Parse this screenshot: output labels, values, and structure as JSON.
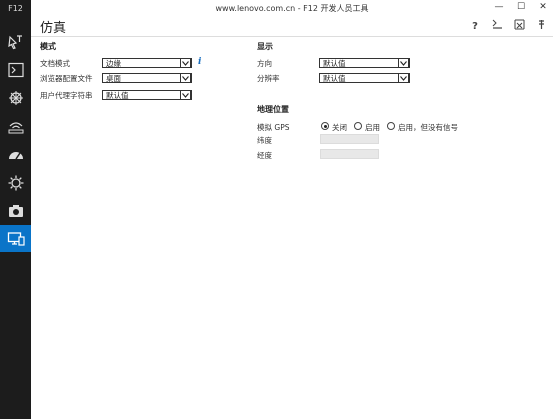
{
  "window": {
    "title": "www.lenovo.com.cn - F12 开发人员工具",
    "app_label": "F12"
  },
  "sidebar": {
    "items": [
      {
        "icon": "dom-explorer-icon"
      },
      {
        "icon": "console-icon"
      },
      {
        "icon": "debugger-icon"
      },
      {
        "icon": "network-icon"
      },
      {
        "icon": "performance-icon"
      },
      {
        "icon": "memory-icon"
      },
      {
        "icon": "camera-icon"
      },
      {
        "icon": "emulation-icon",
        "active": true
      }
    ]
  },
  "page": {
    "title": "仿真",
    "toolbar_help": "?"
  },
  "mode": {
    "heading": "模式",
    "document_mode_label": "文档模式",
    "document_mode_value": "边缘",
    "browser_profile_label": "浏览器配置文件",
    "browser_profile_value": "桌面",
    "user_agent_label": "用户代理字符串",
    "user_agent_value": "默认值"
  },
  "display": {
    "heading": "显示",
    "orientation_label": "方向",
    "orientation_value": "默认值",
    "resolution_label": "分辨率",
    "resolution_value": "默认值"
  },
  "geolocation": {
    "heading": "地理位置",
    "gps_label": "模拟 GPS",
    "option_off": "关闭",
    "option_on": "启用",
    "option_no_signal": "启用，但没有信号",
    "latitude_label": "纬度",
    "longitude_label": "经度"
  }
}
